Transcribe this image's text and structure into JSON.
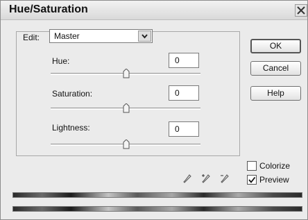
{
  "window": {
    "title": "Hue/Saturation",
    "close_icon": "close-icon"
  },
  "edit": {
    "label": "Edit:",
    "selected": "Master",
    "arrow_icon": "chevron-down-icon"
  },
  "sliders": [
    {
      "label": "Hue:",
      "value": "0"
    },
    {
      "label": "Saturation:",
      "value": "0"
    },
    {
      "label": "Lightness:",
      "value": "0"
    }
  ],
  "buttons": {
    "ok": "OK",
    "cancel": "Cancel",
    "help": "Help"
  },
  "options": {
    "colorize": "Colorize",
    "colorize_checked": false,
    "preview": "Preview",
    "preview_checked": true
  },
  "eyedroppers": [
    "eyedropper-icon",
    "eyedropper-plus-icon",
    "eyedropper-minus-icon"
  ],
  "color_bars": [
    "spectrum-bar",
    "spectrum-bar"
  ]
}
